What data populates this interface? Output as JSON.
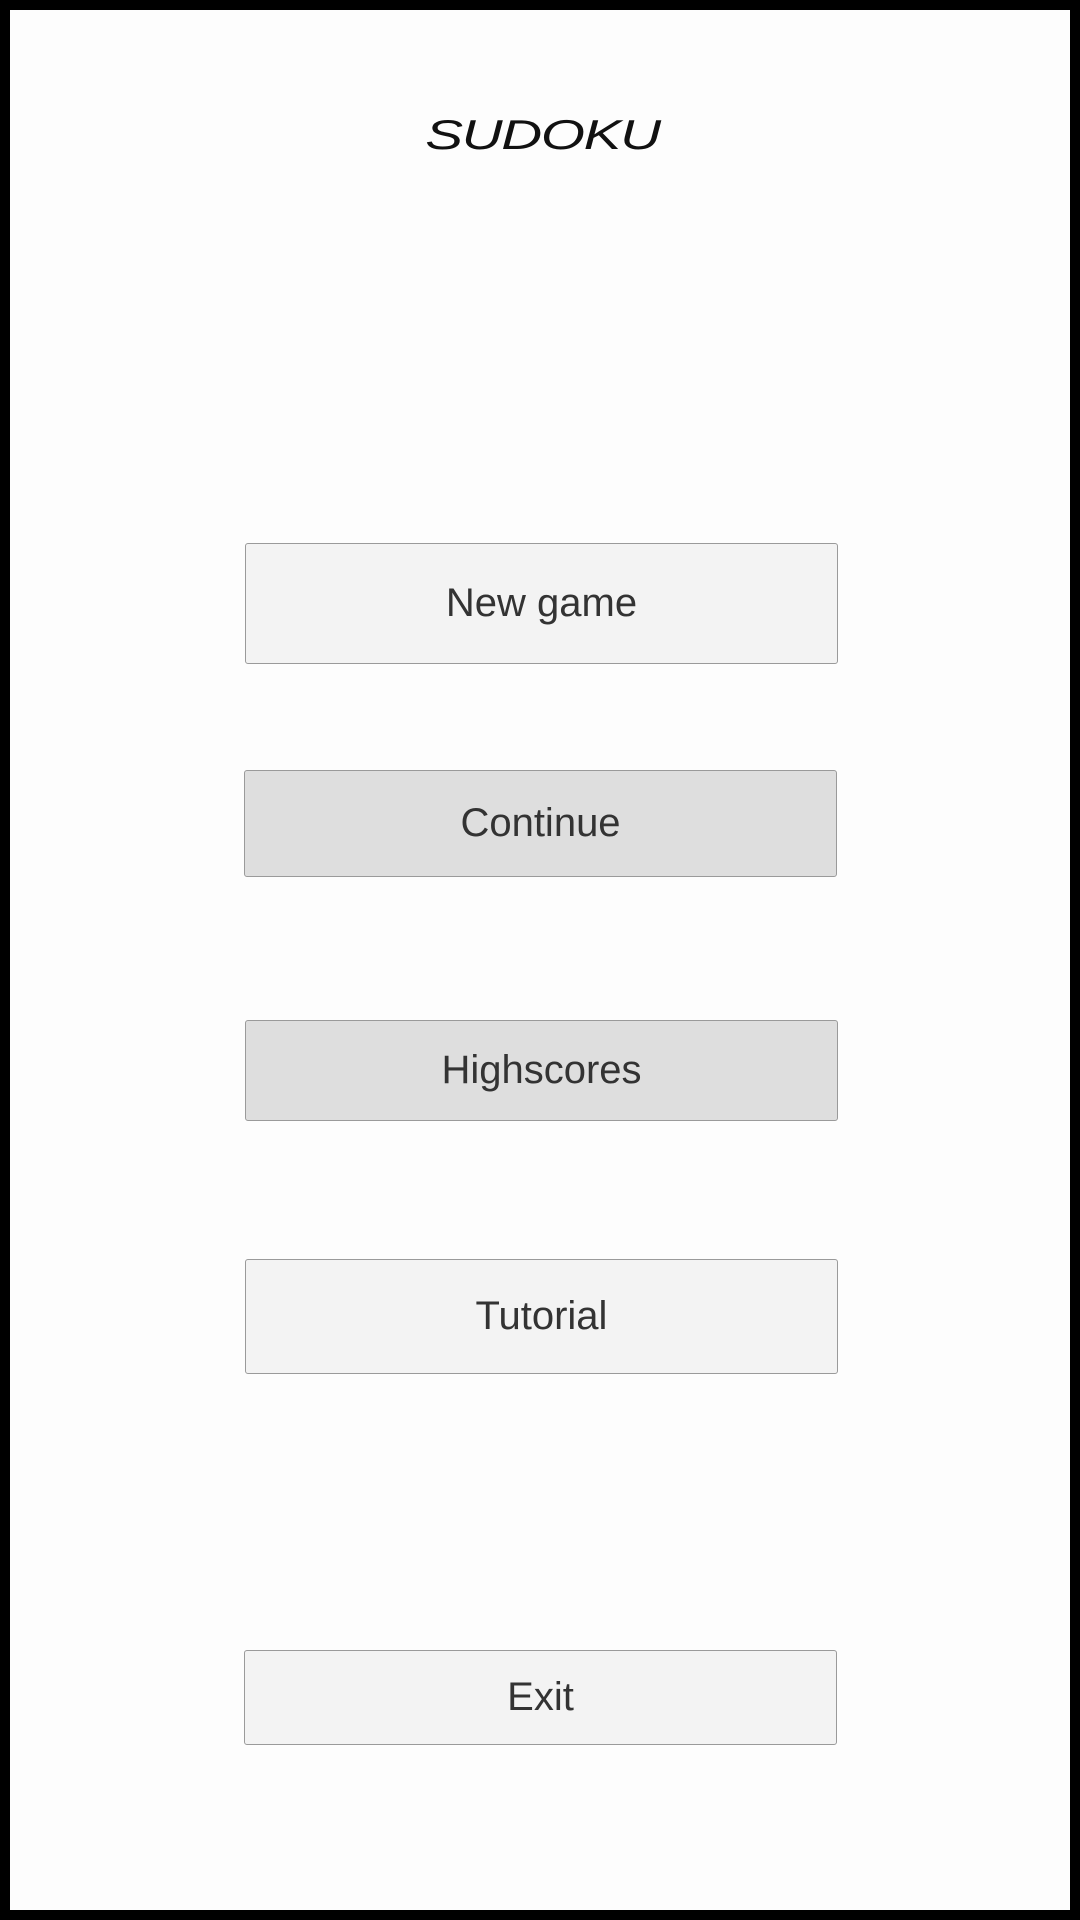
{
  "app": {
    "title": "SUDOKU"
  },
  "menu": {
    "new_game": "New game",
    "continue": "Continue",
    "highscores": "Highscores",
    "tutorial": "Tutorial",
    "exit": "Exit"
  },
  "colors": {
    "frame": "#000000",
    "background": "#fdfdfd",
    "button_light": "#f3f3f3",
    "button_dark": "#dedede",
    "button_border": "#9a9a9a",
    "text": "#333333"
  }
}
